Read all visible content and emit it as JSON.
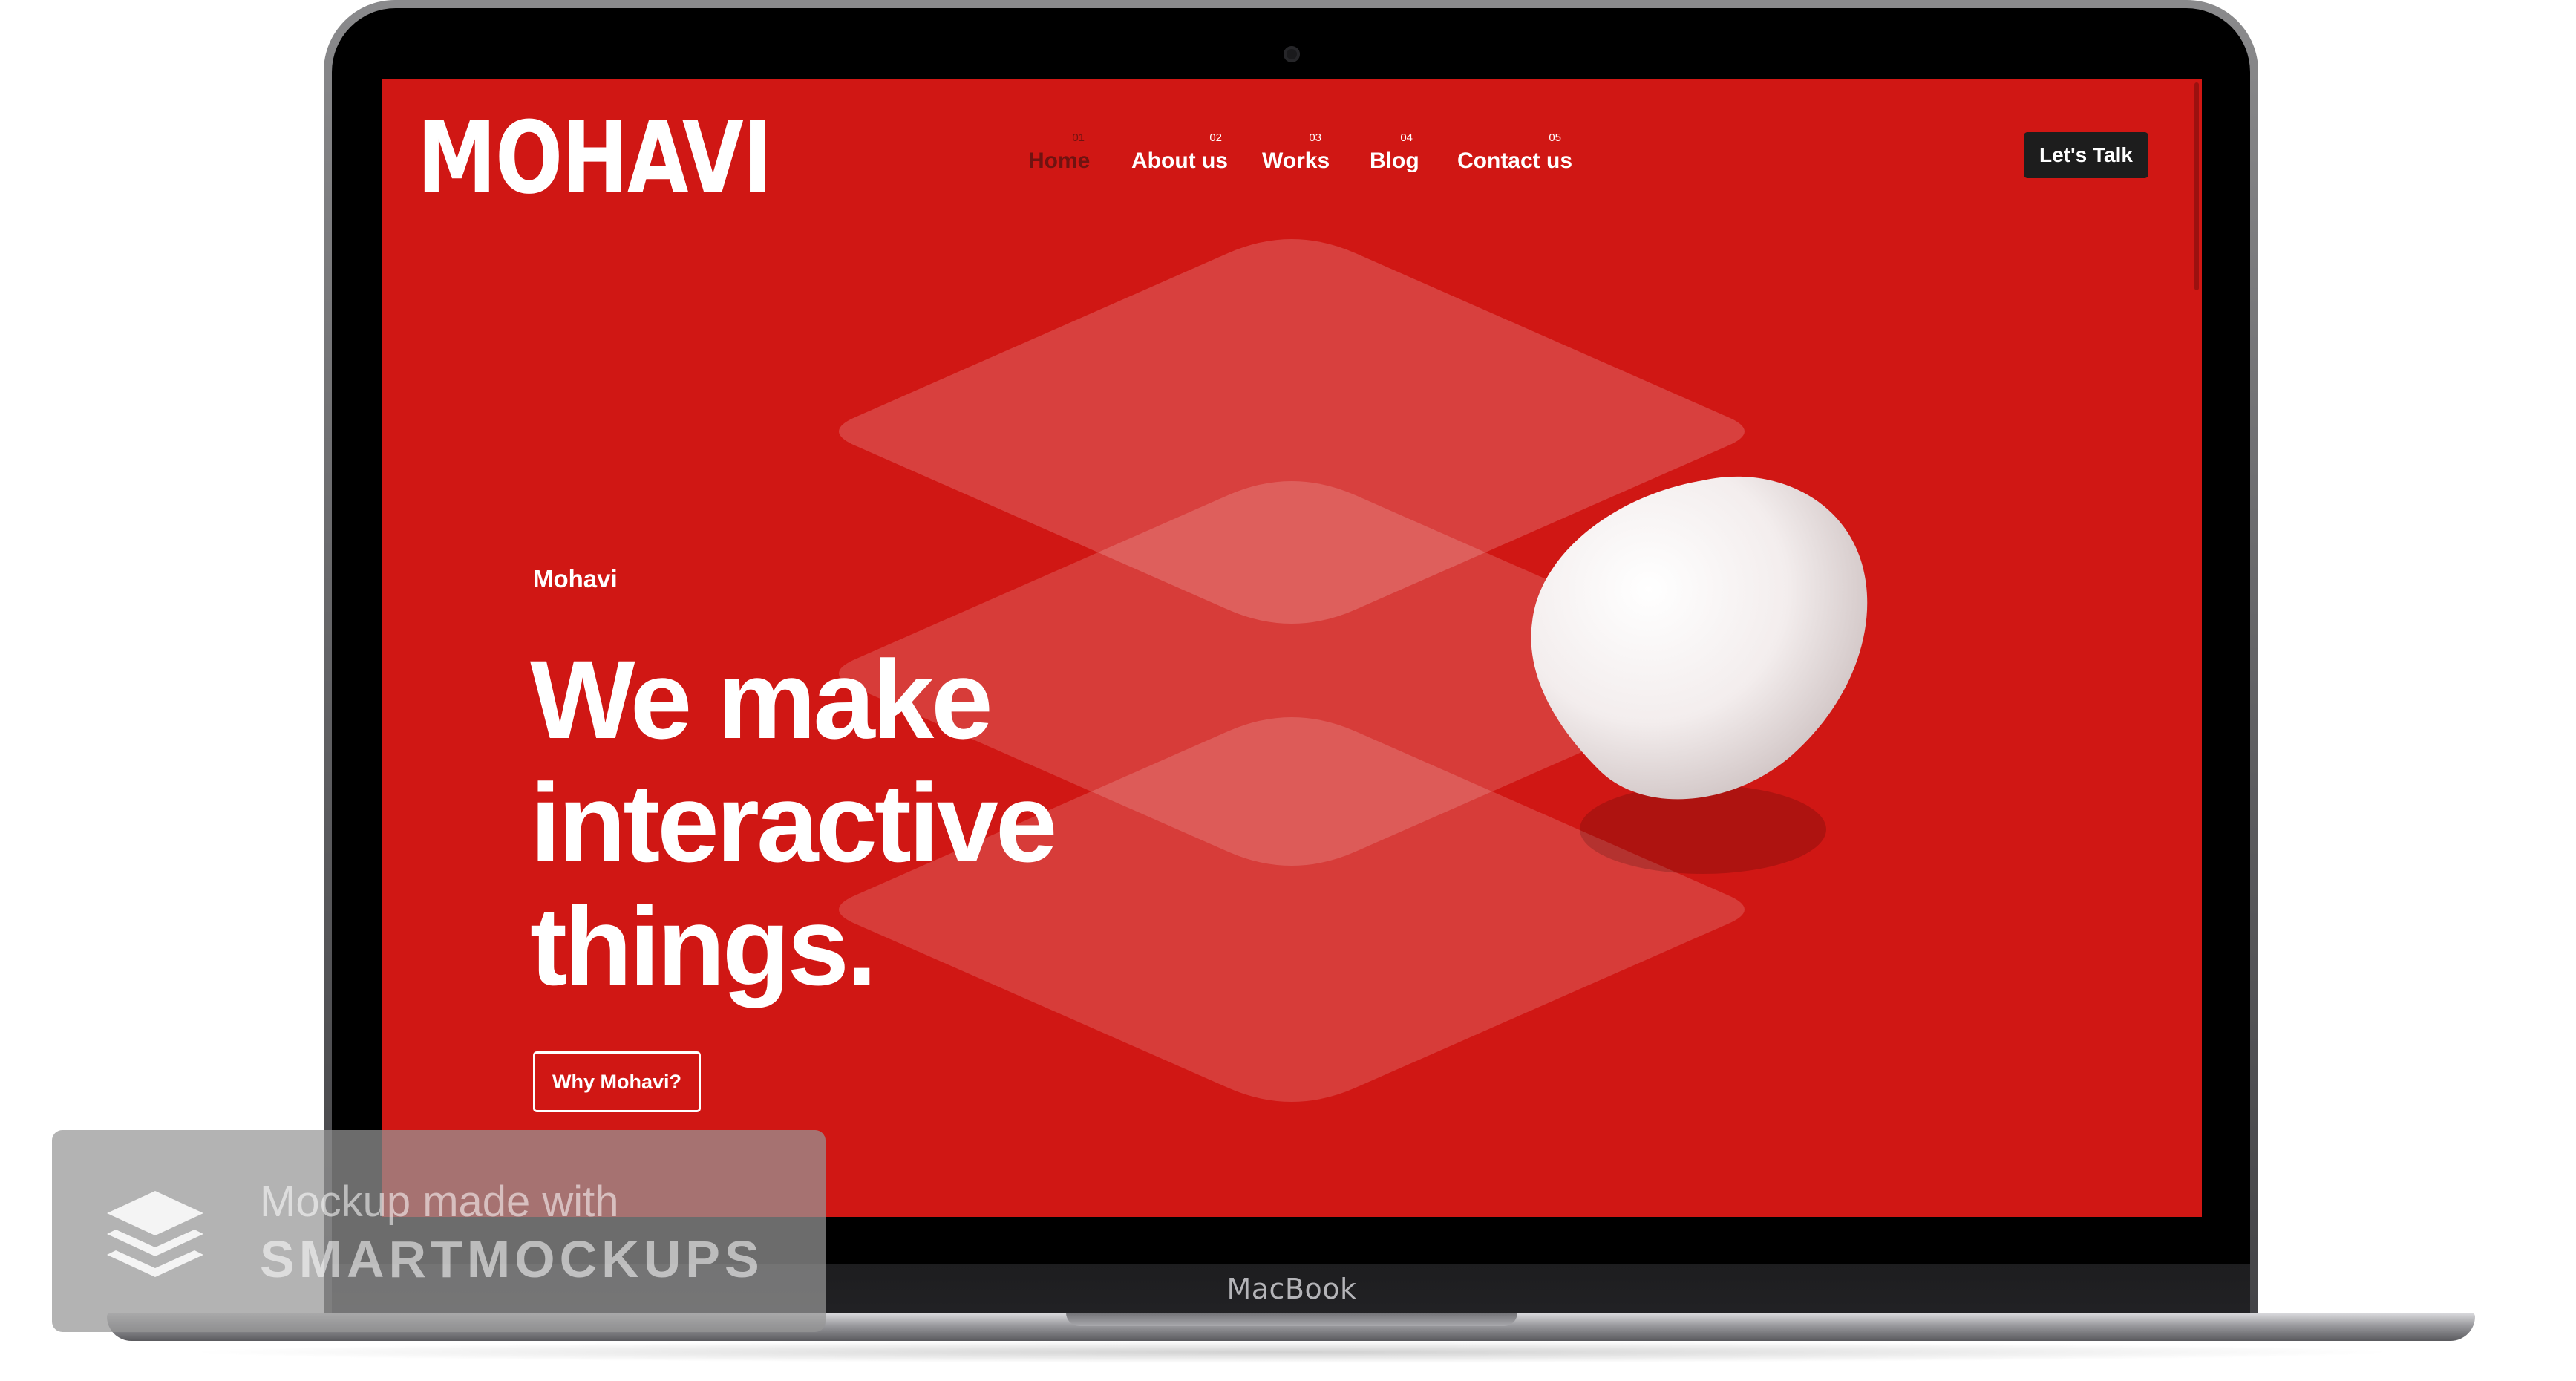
{
  "device": {
    "brand_label": "MacBook"
  },
  "site": {
    "logo_text": "MOHAVI",
    "nav": [
      {
        "number": "01",
        "label": "Home"
      },
      {
        "number": "02",
        "label": "About us"
      },
      {
        "number": "03",
        "label": "Works"
      },
      {
        "number": "04",
        "label": "Blog"
      },
      {
        "number": "05",
        "label": "Contact us"
      }
    ],
    "header_cta": "Let's Talk",
    "hero": {
      "eyebrow": "Mohavi",
      "headline_lines": [
        "We make",
        "interactive",
        "things."
      ],
      "cta": "Why Mohavi?"
    },
    "colors": {
      "background": "#d01714",
      "active_nav": "#6f1311",
      "button_dark": "#1d1d1d",
      "text": "#ffffff"
    }
  },
  "watermark": {
    "line1": "Mockup made with",
    "line2": "SMARTMOCKUPS",
    "icon": "layers-icon"
  }
}
